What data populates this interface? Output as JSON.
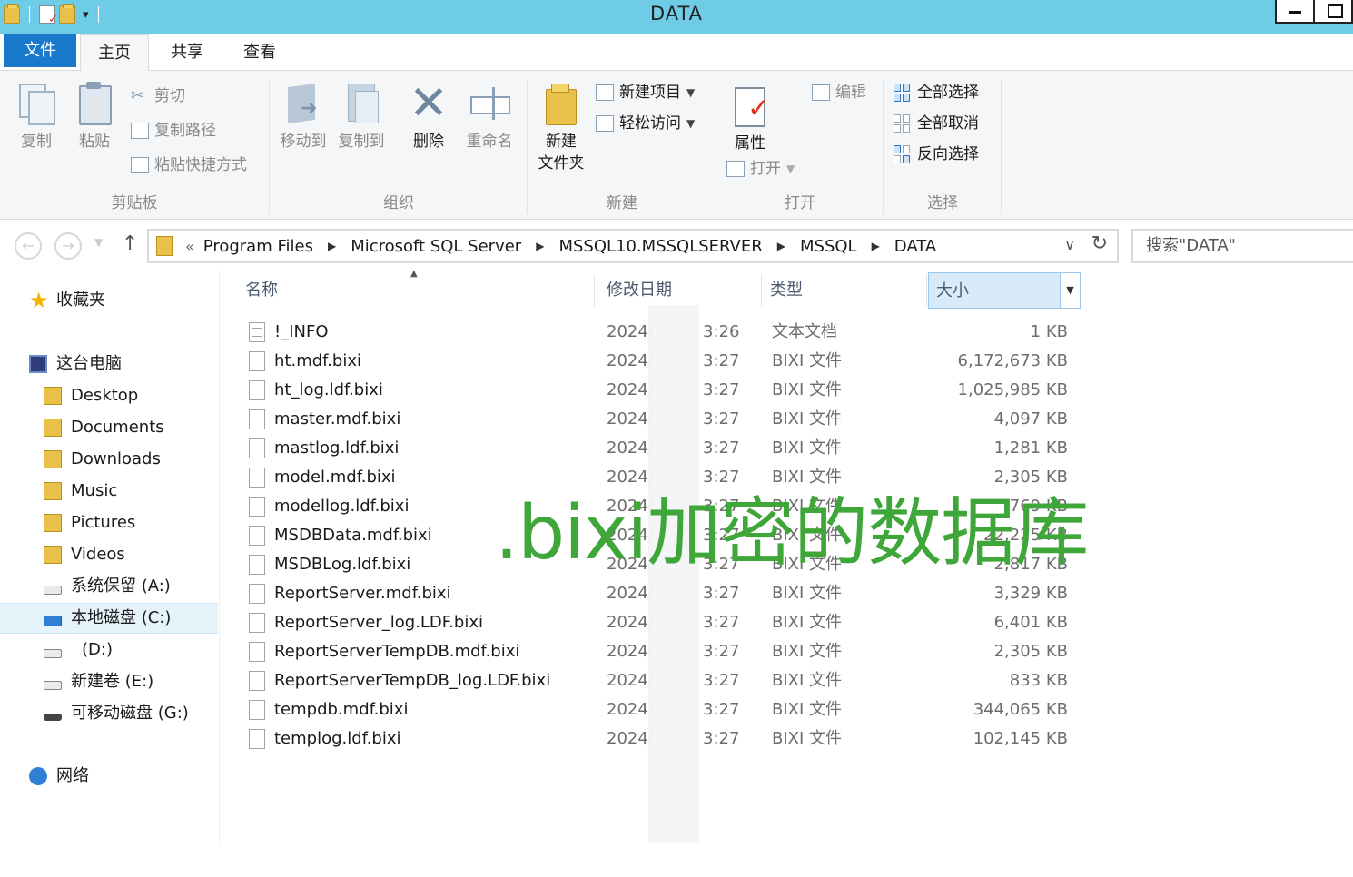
{
  "window": {
    "title": "DATA"
  },
  "tabs": {
    "file": "文件",
    "home": "主页",
    "share": "共享",
    "view": "查看"
  },
  "ribbon": {
    "clipboard": {
      "label": "剪贴板",
      "copy": "复制",
      "paste": "粘贴",
      "cut": "剪切",
      "copy_path": "复制路径",
      "paste_shortcut": "粘贴快捷方式"
    },
    "organize": {
      "label": "组织",
      "move_to": "移动到",
      "copy_to": "复制到",
      "delete": "删除",
      "rename": "重命名"
    },
    "new": {
      "label": "新建",
      "new_folder_line1": "新建",
      "new_folder_line2": "文件夹",
      "new_item": "新建项目",
      "easy_access": "轻松访问"
    },
    "open": {
      "label": "打开",
      "properties": "属性",
      "open": "打开",
      "edit": "编辑"
    },
    "select": {
      "label": "选择",
      "select_all": "全部选择",
      "select_none": "全部取消",
      "invert": "反向选择"
    }
  },
  "address": {
    "breadcrumbs": [
      "Program Files",
      "Microsoft SQL Server",
      "MSSQL10.MSSQLSERVER",
      "MSSQL",
      "DATA"
    ],
    "search_placeholder": "搜索\"DATA\""
  },
  "nav_pane": {
    "favorites": "收藏夹",
    "this_pc": "这台电脑",
    "folders": [
      "Desktop",
      "Documents",
      "Downloads",
      "Music",
      "Pictures",
      "Videos"
    ],
    "drives": [
      "系统保留 (A:)",
      "本地磁盘 (C:)",
      "(D:)",
      "新建卷 (E:)",
      "可移动磁盘 (G:)"
    ],
    "network": "网络"
  },
  "columns": {
    "name": "名称",
    "date": "修改日期",
    "type": "类型",
    "size": "大小"
  },
  "files": [
    {
      "name": "!_INFO",
      "date": "2024/",
      "time": "3:26",
      "type": "文本文档",
      "size": "1 KB"
    },
    {
      "name": "ht.mdf.bixi",
      "date": "2024/",
      "time": "3:27",
      "type": "BIXI 文件",
      "size": "6,172,673 KB"
    },
    {
      "name": "ht_log.ldf.bixi",
      "date": "2024/",
      "time": "3:27",
      "type": "BIXI 文件",
      "size": "1,025,985 KB"
    },
    {
      "name": "master.mdf.bixi",
      "date": "2024/",
      "time": "3:27",
      "type": "BIXI 文件",
      "size": "4,097 KB"
    },
    {
      "name": "mastlog.ldf.bixi",
      "date": "2024/",
      "time": "3:27",
      "type": "BIXI 文件",
      "size": "1,281 KB"
    },
    {
      "name": "model.mdf.bixi",
      "date": "2024/",
      "time": "3:27",
      "type": "BIXI 文件",
      "size": "2,305 KB"
    },
    {
      "name": "modellog.ldf.bixi",
      "date": "2024/",
      "time": "3:27",
      "type": "BIXI 文件",
      "size": "769 KB"
    },
    {
      "name": "MSDBData.mdf.bixi",
      "date": "2024/",
      "time": "3:27",
      "type": "BIXI 文件",
      "size": "22,225 KB"
    },
    {
      "name": "MSDBLog.ldf.bixi",
      "date": "2024/",
      "time": "3:27",
      "type": "BIXI 文件",
      "size": "2,817 KB"
    },
    {
      "name": "ReportServer.mdf.bixi",
      "date": "2024/",
      "time": "3:27",
      "type": "BIXI 文件",
      "size": "3,329 KB"
    },
    {
      "name": "ReportServer_log.LDF.bixi",
      "date": "2024/",
      "time": "3:27",
      "type": "BIXI 文件",
      "size": "6,401 KB"
    },
    {
      "name": "ReportServerTempDB.mdf.bixi",
      "date": "2024/",
      "time": "3:27",
      "type": "BIXI 文件",
      "size": "2,305 KB"
    },
    {
      "name": "ReportServerTempDB_log.LDF.bixi",
      "date": "2024/",
      "time": "3:27",
      "type": "BIXI 文件",
      "size": "833 KB"
    },
    {
      "name": "tempdb.mdf.bixi",
      "date": "2024/",
      "time": "3:27",
      "type": "BIXI 文件",
      "size": "344,065 KB"
    },
    {
      "name": "templog.ldf.bixi",
      "date": "2024/",
      "time": "3:27",
      "type": "BIXI 文件",
      "size": "102,145 KB"
    }
  ],
  "overlay_caption": ".bixi加密的数据库",
  "colors": {
    "titlebar": "#6fcce6",
    "file_tab": "#1979ca",
    "caption": "#3fa63a"
  }
}
